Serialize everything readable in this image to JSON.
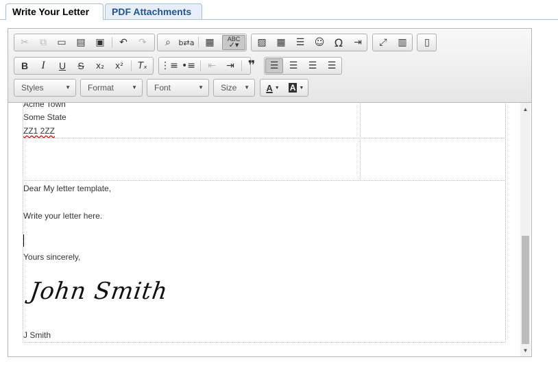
{
  "tabs": [
    {
      "label": "Write Your Letter",
      "active": true
    },
    {
      "label": "PDF Attachments",
      "active": false
    }
  ],
  "toolbar": {
    "row1": [
      {
        "name": "cut-icon",
        "glyph": "✂",
        "enabled": false
      },
      {
        "name": "copy-icon",
        "glyph": "⧉",
        "enabled": false
      },
      {
        "name": "paste-icon",
        "glyph": "📋",
        "enabled": true
      },
      {
        "name": "paste-text-icon",
        "glyph": "📋",
        "enabled": true
      },
      {
        "name": "paste-word-icon",
        "glyph": "📋",
        "enabled": true
      },
      {
        "name": "undo-icon",
        "glyph": "↶",
        "enabled": true
      },
      {
        "name": "redo-icon",
        "glyph": "↷",
        "enabled": false
      },
      {
        "name": "find-icon",
        "glyph": "🔍",
        "enabled": true
      },
      {
        "name": "replace-icon",
        "glyph": "⇆",
        "enabled": true
      },
      {
        "name": "format-painter-icon",
        "glyph": "▦",
        "enabled": true
      },
      {
        "name": "spellcheck-icon",
        "glyph": "✓",
        "enabled": true
      },
      {
        "name": "image-icon",
        "glyph": "🖼",
        "enabled": true
      },
      {
        "name": "table-icon",
        "glyph": "▦",
        "enabled": true
      },
      {
        "name": "horizontal-line-icon",
        "glyph": "☰",
        "enabled": true
      },
      {
        "name": "smiley-icon",
        "glyph": "☺",
        "enabled": true
      },
      {
        "name": "special-char-icon",
        "glyph": "Ω",
        "enabled": true
      },
      {
        "name": "page-break-icon",
        "glyph": "⇥",
        "enabled": true
      },
      {
        "name": "maximize-icon",
        "glyph": "⤢",
        "enabled": true
      },
      {
        "name": "show-blocks-icon",
        "glyph": "▤",
        "enabled": true
      },
      {
        "name": "source-icon",
        "glyph": "🗎",
        "enabled": true
      }
    ],
    "spellcheck_label": "ABC",
    "row2": [
      {
        "name": "bold-icon",
        "glyph": "B"
      },
      {
        "name": "italic-icon",
        "glyph": "I"
      },
      {
        "name": "underline-icon",
        "glyph": "U"
      },
      {
        "name": "strikethrough-icon",
        "glyph": "S"
      },
      {
        "name": "subscript-icon",
        "glyph": "x₂"
      },
      {
        "name": "superscript-icon",
        "glyph": "x²"
      },
      {
        "name": "remove-format-icon",
        "glyph": "Tₓ"
      },
      {
        "name": "numbered-list-icon",
        "glyph": "⒈"
      },
      {
        "name": "bulleted-list-icon",
        "glyph": "•"
      },
      {
        "name": "outdent-icon",
        "glyph": "⇤"
      },
      {
        "name": "indent-icon",
        "glyph": "⇥"
      },
      {
        "name": "blockquote-icon",
        "glyph": "❞"
      },
      {
        "name": "align-left-icon",
        "glyph": "≡"
      },
      {
        "name": "align-center-icon",
        "glyph": "≡"
      },
      {
        "name": "align-right-icon",
        "glyph": "≡"
      },
      {
        "name": "align-justify-icon",
        "glyph": "≡"
      }
    ],
    "combos": {
      "styles": "Styles",
      "format": "Format",
      "font": "Font",
      "size": "Size"
    },
    "text_color_label": "A",
    "bg_color_label": "A"
  },
  "letter": {
    "address_partial": "Acme Town",
    "state": "Some State",
    "postcode": "ZZ1 2ZZ",
    "greeting": "Dear My letter template,",
    "body": "Write your letter here.",
    "closing": "Yours sincerely,",
    "signature": "John Smith",
    "signoff": "J Smith"
  },
  "colors": {
    "tab_active_text": "#000000",
    "tab_inactive_text": "#1e5390",
    "tab_border": "#a9bfd6"
  }
}
